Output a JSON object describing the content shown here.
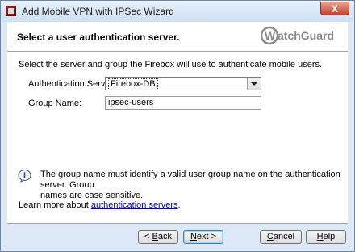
{
  "window": {
    "title": "Add Mobile VPN with IPSec Wizard",
    "close_label": "X"
  },
  "header": {
    "title": "Select a user authentication server.",
    "logo_text": "WatchGuard"
  },
  "body": {
    "intro": "Select the server and group the Firebox will use to authenticate mobile users.",
    "auth_server": {
      "label": "Authentication Server:",
      "value": "Firebox-DB"
    },
    "group_name": {
      "label": "Group Name:",
      "value": "ipsec-users"
    },
    "info_line1": "The group name must identify a valid user group name on the authentication server. Group",
    "info_line2": "names are case sensitive.",
    "learn_prefix": "Learn more about ",
    "learn_link": "authentication servers",
    "learn_suffix": "."
  },
  "buttons": {
    "back_mnemonic": "< ",
    "back_u": "B",
    "back_rest": "ack",
    "next_u": "N",
    "next_rest": "ext >",
    "cancel_u": "C",
    "cancel_rest": "ancel",
    "help_u": "H",
    "help_rest": "elp"
  },
  "colors": {
    "accent": "#c8412a",
    "link": "#0000cc",
    "window_bg": "#dde9f7"
  }
}
